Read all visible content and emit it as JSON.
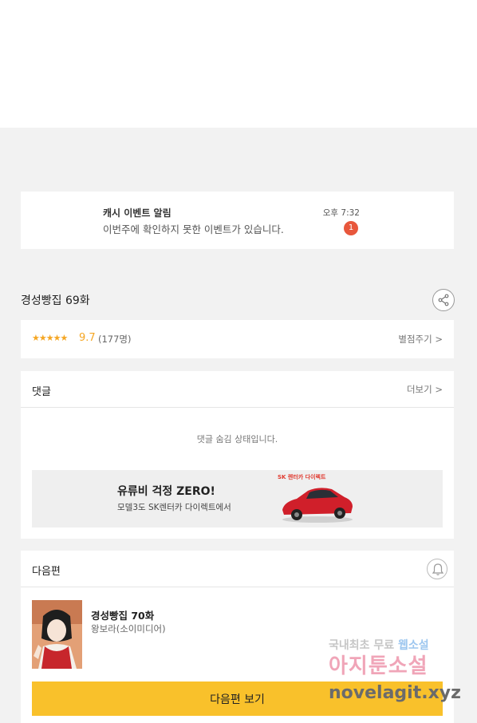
{
  "notification": {
    "title": "캐시 이벤트 알림",
    "message": "이번주에 확인하지 못한 이벤트가 있습니다.",
    "time": "오후 7:32",
    "badge": "1"
  },
  "episode": {
    "title": "경성빵집 69화",
    "stars": "★★★★★",
    "score": "9.7",
    "count": "(177명)",
    "rate_link": "별점주기 >"
  },
  "comments": {
    "label": "댓글",
    "more": "더보기 >",
    "empty": "댓글 숨김 상태입니다."
  },
  "ad": {
    "headline": "유류비 걱정 ZERO!",
    "sub": "모델3도 SK렌터카 다이렉트에서",
    "brand": "SK 렌터카 다이렉트"
  },
  "next": {
    "label": "다음편",
    "episode_title": "경성빵집 70화",
    "author": "왕보라(소이미디어)",
    "button": "다음편 보기"
  },
  "watermark": {
    "line1": "국내최초 무료",
    "line1_accent": "웹소설",
    "line2": "아지툰소설",
    "line3": "novelagit.xyz"
  }
}
